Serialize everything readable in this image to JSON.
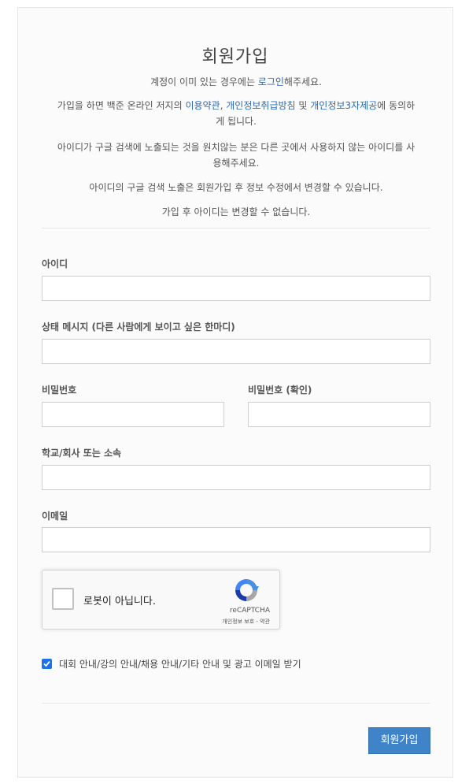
{
  "page": {
    "title": "회원가입"
  },
  "info": {
    "line1_pre": "계정이 이미 있는 경우에는 ",
    "line1_link": "로그인",
    "line1_post": "해주세요.",
    "line2_pre": "가입을 하면 백준 온라인 저지의 ",
    "terms_link": "이용약관",
    "sep1": ", ",
    "privacy_link": "개인정보취급방침",
    "sep2": " 및 ",
    "thirdparty_link": "개인정보3자제공",
    "line2_post_a": "에 동의하",
    "line2_post_b": "게 됩니다.",
    "line3a": "아이디가 구글 검색에 노출되는 것을 원치않는 분은 다른 곳에서 사용하지 않는 아이디를 사",
    "line3b": "용해주세요.",
    "line4": "아이디의 구글 검색 노출은 회원가입 후 정보 수정에서 변경할 수 있습니다.",
    "line5": "가입 후 아이디는 변경할 수 없습니다."
  },
  "form": {
    "username_label": "아이디",
    "username_value": "",
    "status_label": "상태 메시지 (다른 사람에게 보이고 싶은 한마디)",
    "status_value": "",
    "password_label": "비밀번호",
    "password_value": "",
    "password_confirm_label": "비밀번호 (확인)",
    "password_confirm_value": "",
    "school_label": "학교/회사 또는 소속",
    "school_value": "",
    "email_label": "이메일",
    "email_value": ""
  },
  "captcha": {
    "label": "로봇이 아닙니다.",
    "brand": "reCAPTCHA",
    "links": "개인정보 보호 - 약관"
  },
  "consent": {
    "checked": true,
    "label": "대회 안내/강의 안내/채용 안내/기타 안내 및 광고 이메일 받기"
  },
  "submit_label": "회원가입",
  "colors": {
    "link": "#2a6bb3",
    "button": "#3f84c8",
    "checkbox": "#1a73e8"
  }
}
